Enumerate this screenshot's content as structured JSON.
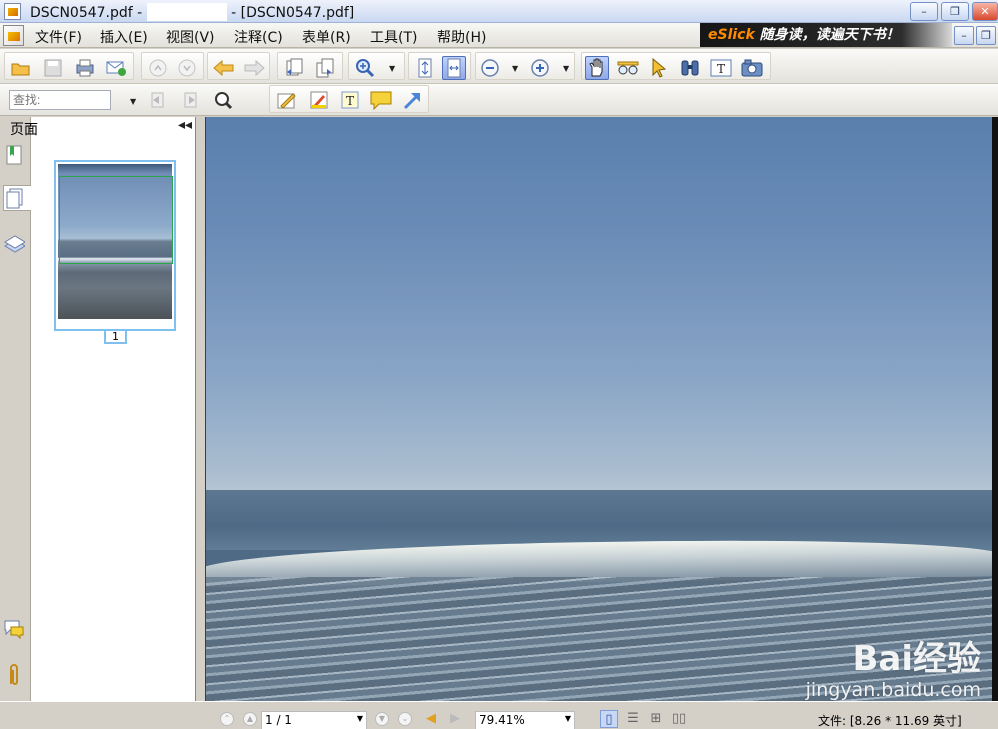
{
  "window": {
    "title_prefix": "DSCN0547.pdf -",
    "title_suffix": "- [DSCN0547.pdf]",
    "minimize": "–",
    "restore": "❐",
    "close": "✕"
  },
  "menu": {
    "items": [
      "文件(F)",
      "插入(E)",
      "视图(V)",
      "注释(C)",
      "表单(R)",
      "工具(T)",
      "帮助(H)"
    ],
    "banner_brand": "eSlick",
    "banner_text": "随身读，读遍天下书！",
    "mdi_minimize": "–",
    "mdi_restore": "❐"
  },
  "toolbar": {
    "find_placeholder": "查找:"
  },
  "sidebar": {
    "panel_title": "页面",
    "collapse_glyph": "◂◂",
    "thumbnail_page": "1"
  },
  "document": {
    "watermark_main": "Bai经验",
    "watermark_url": "jingyan.baidu.com"
  },
  "statusbar": {
    "page_value": "1 / 1",
    "zoom_value": "79.41%",
    "file_info": "文件: [8.26 * 11.69 英寸]"
  },
  "colors": {
    "active_tool": "#8fa8e8",
    "thumb_border": "#7fc0ee"
  }
}
